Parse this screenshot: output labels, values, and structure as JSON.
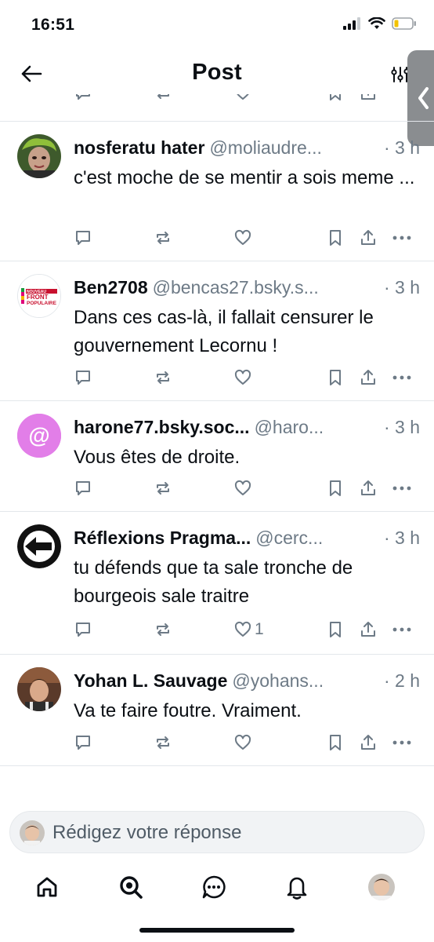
{
  "status_bar": {
    "time": "16:51"
  },
  "header": {
    "title": "Post"
  },
  "posts": [
    {
      "author": "nosferatu hater",
      "handle": "@moliaudre...",
      "time": "· 3 h",
      "text": "c'est moche de se mentir a sois meme ...",
      "likes": ""
    },
    {
      "author": "Ben2708",
      "handle": "@bencas27.bsky.s...",
      "time": "· 3 h",
      "text": "Dans ces cas-là, il fallait censurer le gouvernement Lecornu !",
      "likes": "",
      "avatar_text": [
        "NOUVEAU",
        "FRONT",
        "POPULAIRE"
      ]
    },
    {
      "author": "harone77.bsky.soc...",
      "handle": "@haro...",
      "time": "· 3 h",
      "text": "Vous êtes de droite.",
      "likes": "",
      "avatar_symbol": "@"
    },
    {
      "author": "Réflexions Pragma...",
      "handle": "@cerc...",
      "time": "· 3 h",
      "text": "tu défends que ta sale tronche de bourgeois sale traitre",
      "likes": "1"
    },
    {
      "author": "Yohan L. Sauvage",
      "handle": "@yohans...",
      "time": "· 2 h",
      "text": "Va te faire foutre. Vraiment.",
      "likes": ""
    }
  ],
  "composer": {
    "placeholder": "Rédigez votre réponse"
  },
  "nav": [
    "home-icon",
    "search-icon",
    "chat-icon",
    "notifications-icon",
    "profile-avatar"
  ],
  "colors": {
    "text": "#0b0f14",
    "muted": "#6d7a86",
    "divider": "#e3e7eb",
    "accent_blue": "#1083fe",
    "harone_avatar": "#e27ee8"
  }
}
